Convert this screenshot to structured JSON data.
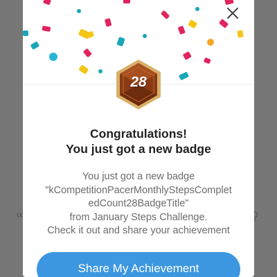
{
  "dialog": {
    "badge_number": "28",
    "title_line1": "Congratulations!",
    "title_line2": "You just got a new badge",
    "body_line1": "You just got a new badge",
    "body_line2": "\"kCompetitionPacerMonthlyStepsComplet",
    "body_line3": "edCount28BadgeTitle\"",
    "body_line4": "from January Steps Challenge.",
    "body_line5": "Check it out and share your achievement",
    "share_button_label": "Share My Achievement",
    "close_icon": "close-icon"
  },
  "colors": {
    "accent": "#3d97e0",
    "badge_border": "#d8b06a",
    "badge_fill": "#8a3a14"
  }
}
